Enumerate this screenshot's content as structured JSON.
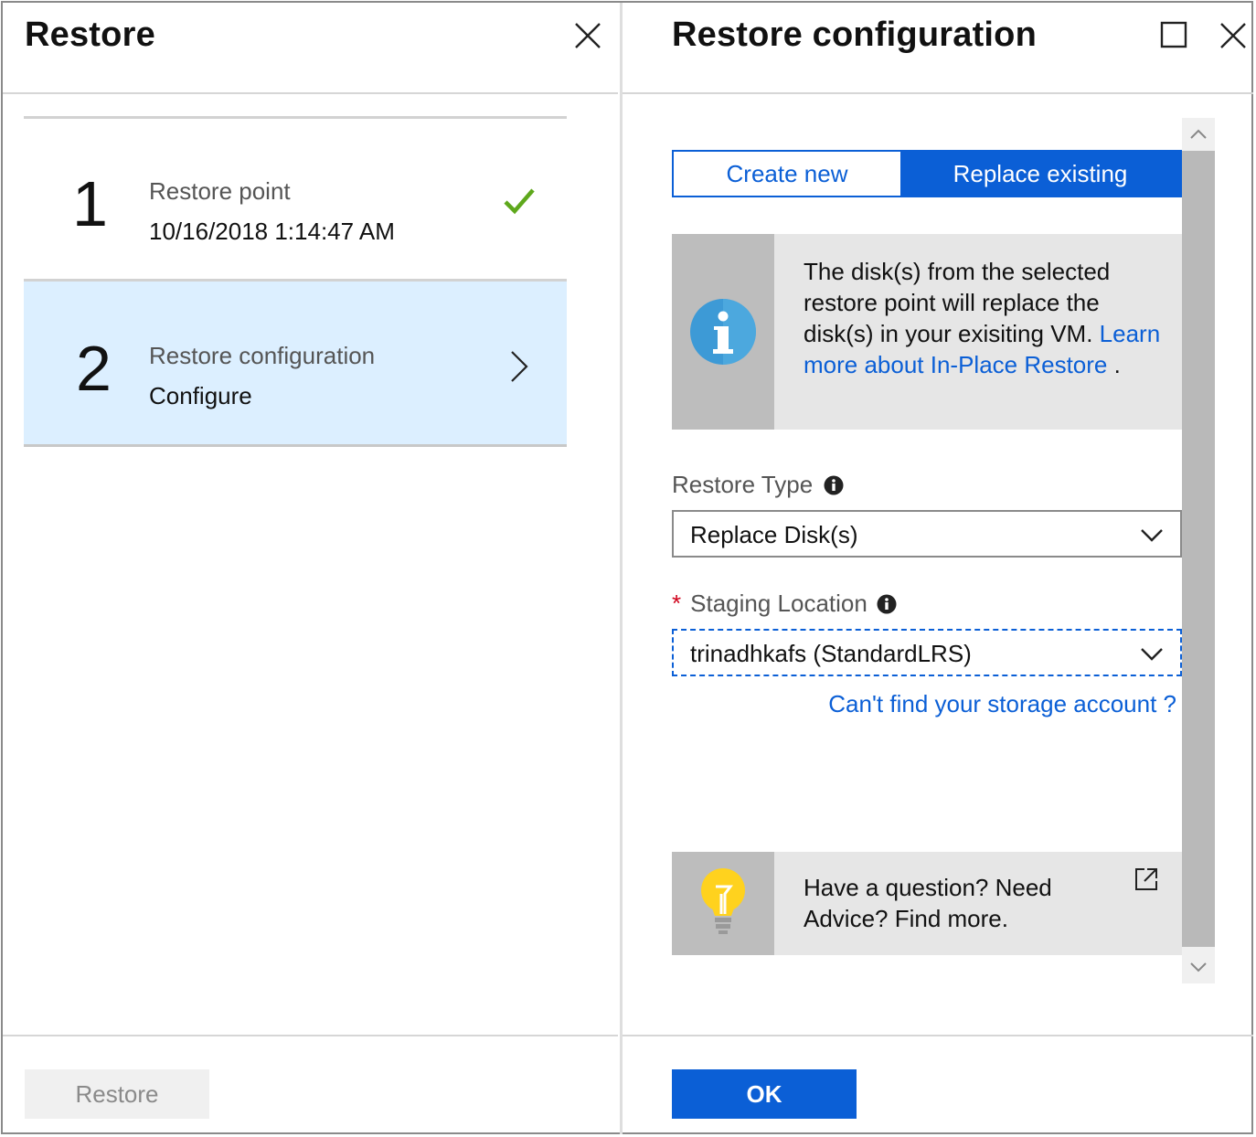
{
  "left_blade": {
    "title": "Restore",
    "steps": [
      {
        "number": "1",
        "label": "Restore point",
        "value": "10/16/2018 1:14:47 AM",
        "status": "complete"
      },
      {
        "number": "2",
        "label": "Restore configuration",
        "value": "Configure",
        "status": "selected"
      }
    ],
    "restore_button": "Restore"
  },
  "right_blade": {
    "title": "Restore configuration",
    "toggle": {
      "options": [
        "Create new",
        "Replace existing"
      ],
      "selected": "Replace existing"
    },
    "info": {
      "text": "The disk(s) from the selected restore point will replace the disk(s) in your exisiting VM.",
      "link": "Learn more about In-Place Restore",
      "suffix": " ."
    },
    "restore_type": {
      "label": "Restore Type",
      "value": "Replace Disk(s)"
    },
    "staging_location": {
      "required_mark": "*",
      "label": "Staging Location",
      "value": "trinadhkafs (StandardLRS)"
    },
    "storage_link": "Can't find your storage account ?",
    "help": {
      "text": "Have a question? Need Advice? Find more."
    },
    "ok_button": "OK"
  },
  "colors": {
    "accent": "#0b5fd6",
    "selected_row": "#dcefff",
    "check": "#5ea81c",
    "required": "#d0021b"
  }
}
